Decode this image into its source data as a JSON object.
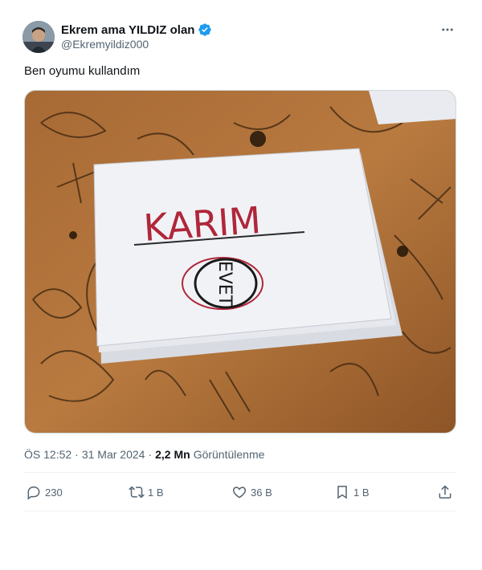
{
  "author": {
    "display_name": "Ekrem ama YILDIZ olan",
    "handle": "@Ekremyildiz000",
    "verified": true
  },
  "tweet": {
    "text": "Ben oyumu kullandım",
    "time": "ÖS 12:52",
    "date": "31 Mar 2024",
    "views_value": "2,2 Mn",
    "views_label": "Görüntülenme"
  },
  "photo": {
    "paper_word": "KARIM",
    "stamp_word": "EVET"
  },
  "actions": {
    "replies": "230",
    "reposts": "1 B",
    "likes": "36 B",
    "bookmarks": "1 B"
  },
  "colors": {
    "verified_blue": "#1d9bf0",
    "secondary_text": "#536471",
    "primary_text": "#0f1419"
  }
}
